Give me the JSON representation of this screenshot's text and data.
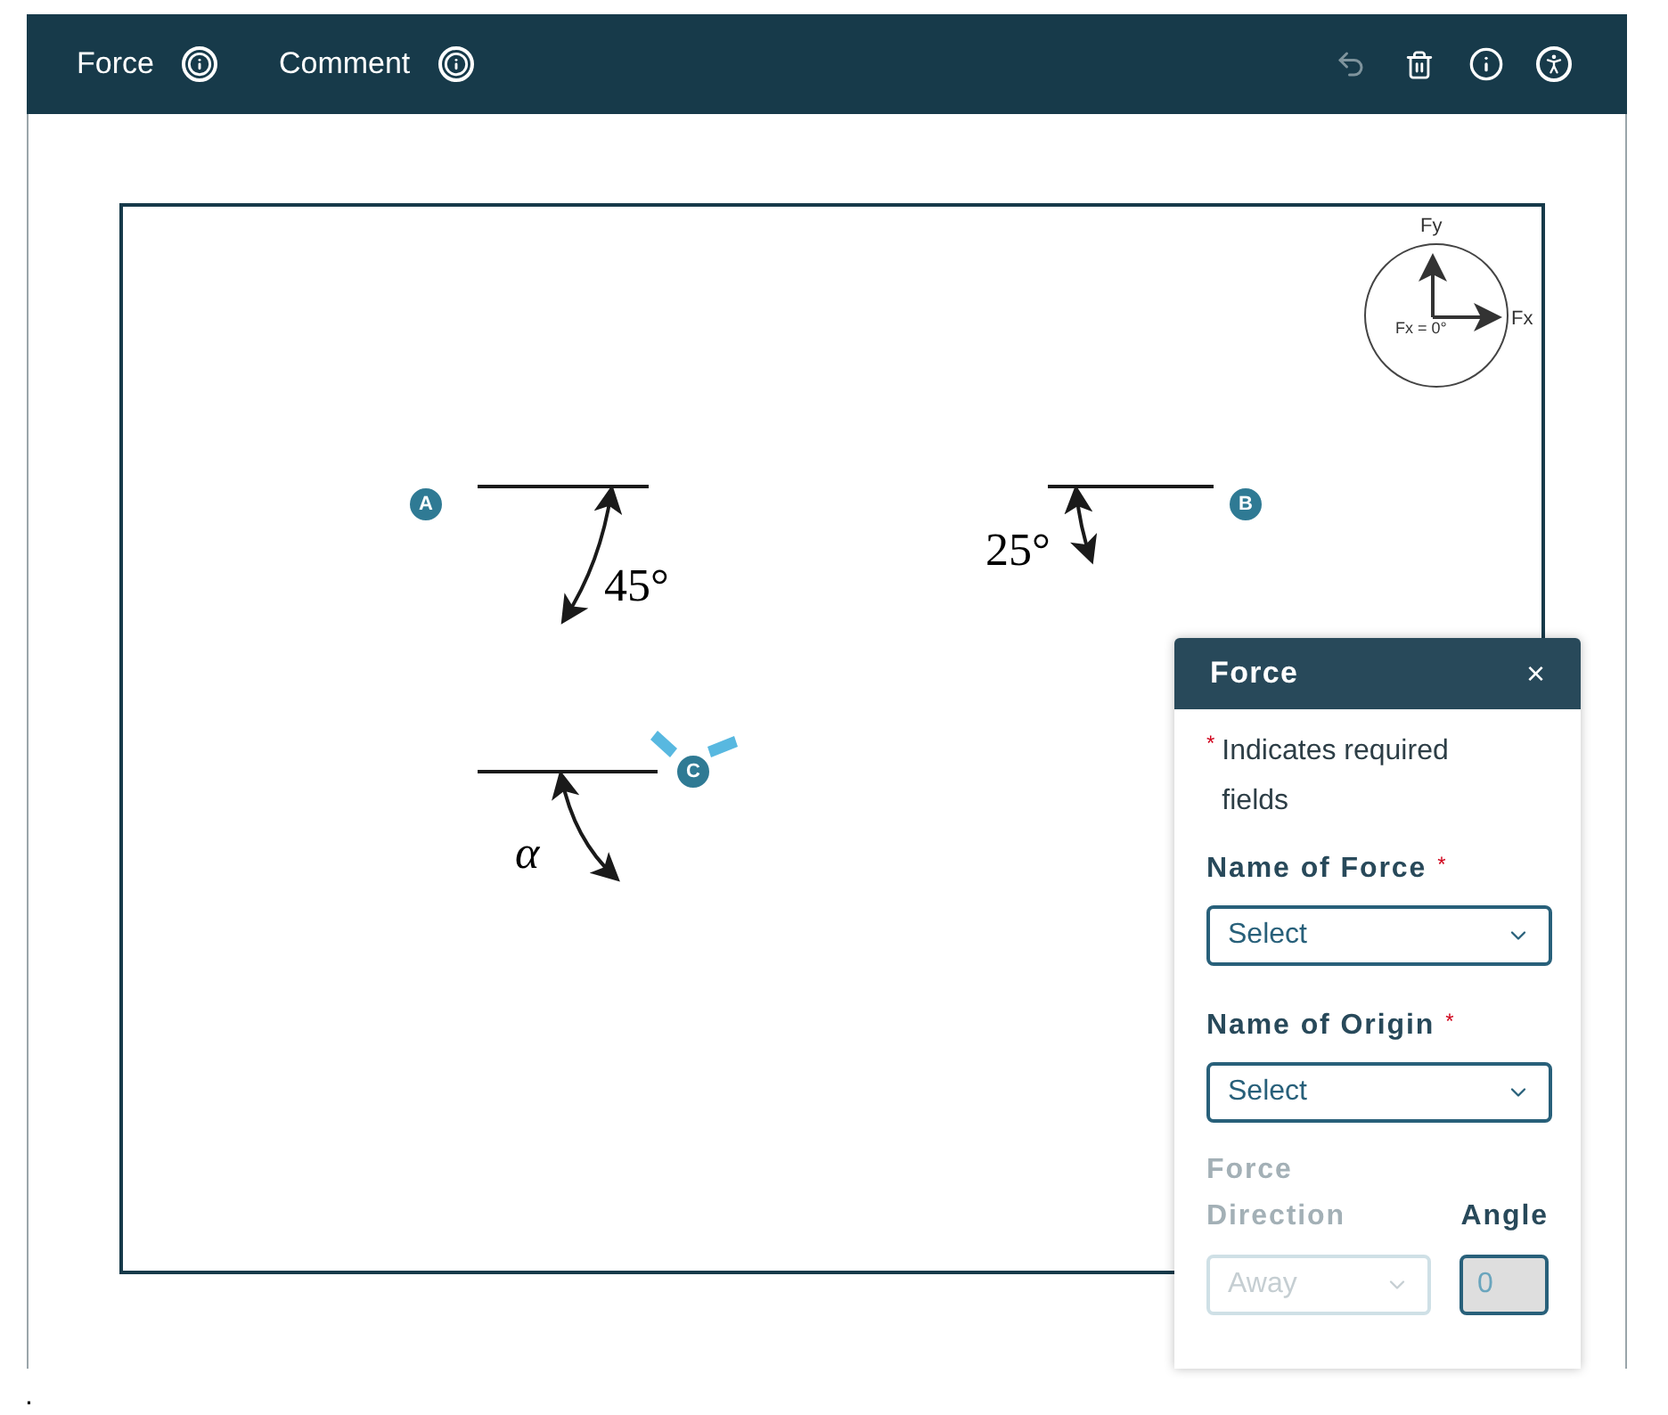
{
  "toolbar": {
    "tools": [
      {
        "label": "Force"
      },
      {
        "label": "Comment"
      }
    ],
    "actions": [
      {
        "kind": "undo",
        "disabled": true
      },
      {
        "kind": "delete",
        "disabled": false
      },
      {
        "kind": "info",
        "disabled": false
      },
      {
        "kind": "accessibility",
        "disabled": false
      }
    ]
  },
  "diagram": {
    "points": [
      {
        "label": "A"
      },
      {
        "label": "B"
      },
      {
        "label": "C"
      }
    ],
    "angles": [
      "45°",
      "25°",
      "α"
    ],
    "compass": {
      "y": "Fy",
      "x": "Fx",
      "reading": "Fx = 0°"
    }
  },
  "panel": {
    "title": "Force",
    "close": "×",
    "required_mark": "*",
    "required_note": "Indicates required fields",
    "fields": [
      {
        "label": "Name of Force",
        "required_mark": "*",
        "value": "Select"
      },
      {
        "label": "Name of Origin",
        "required_mark": "*",
        "value": "Select"
      }
    ],
    "direction": {
      "label": "Force Direction",
      "value": "Away",
      "disabled": true
    },
    "angle": {
      "label": "Angle",
      "value": "0"
    }
  },
  "footnote": "."
}
